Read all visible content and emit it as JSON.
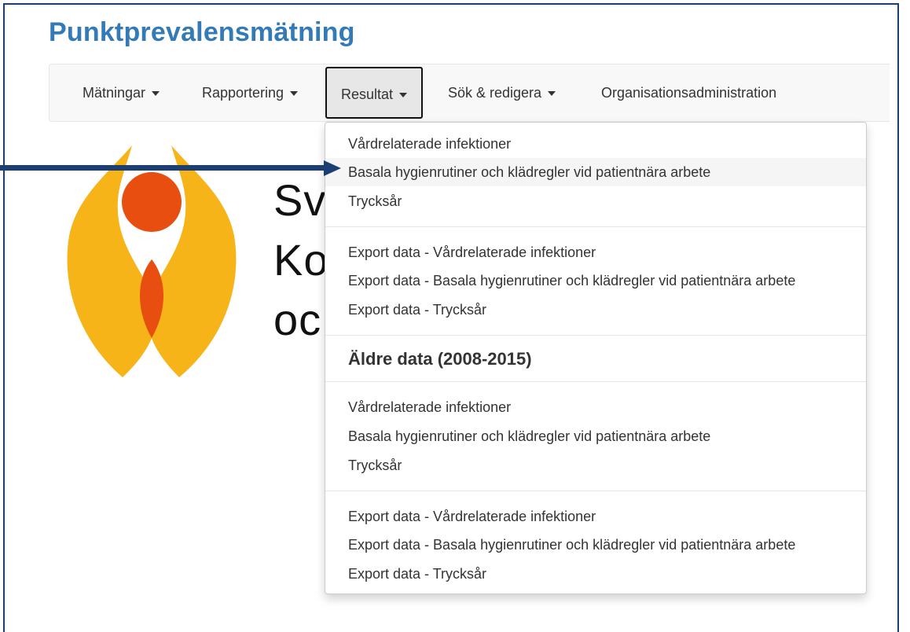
{
  "app": {
    "title": "Punktprevalensmätning"
  },
  "nav": {
    "items": [
      {
        "label": "Mätningar",
        "has_caret": true
      },
      {
        "label": "Rapportering",
        "has_caret": true
      },
      {
        "label": "Resultat",
        "has_caret": true,
        "active": true
      },
      {
        "label": "Sök & redigera",
        "has_caret": true
      },
      {
        "label": "Organisationsadministration",
        "has_caret": false
      }
    ]
  },
  "background": {
    "text_lines": [
      "Sv",
      "Ko",
      "oc"
    ]
  },
  "resultat_menu": {
    "group1": [
      "Vårdrelaterade infektioner",
      "Basala hygienrutiner och klädregler vid patientnära arbete",
      "Trycksår"
    ],
    "group2": [
      "Export data - Vårdrelaterade infektioner",
      "Export data - Basala hygienrutiner och klädregler vid patientnära arbete",
      "Export data - Trycksår"
    ],
    "header": "Äldre data (2008-2015)",
    "group3": [
      "Vårdrelaterade infektioner",
      "Basala hygienrutiner och klädregler vid patientnära arbete",
      "Trycksår"
    ],
    "group4": [
      "Export data - Vårdrelaterade infektioner",
      "Export data - Basala hygienrutiner och klädregler vid patientnära arbete",
      "Export data - Trycksår"
    ],
    "highlighted_item": "Basala hygienrutiner och klädregler vid patientnära arbete"
  },
  "colors": {
    "title_blue": "#337ab7",
    "arrow_navy": "#1c3f73",
    "logo_yellow": "#f6b418",
    "logo_orange": "#e84e0f"
  }
}
